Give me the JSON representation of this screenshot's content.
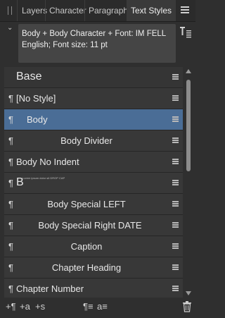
{
  "tabs": [
    {
      "label": "Layers",
      "active": false
    },
    {
      "label": "Character",
      "active": false
    },
    {
      "label": "Paragraph",
      "active": false
    },
    {
      "label": "Text Styles",
      "active": true
    }
  ],
  "description": {
    "text": "Body + Body Character + Font: IM FELL English; Font size: 11 pt"
  },
  "list": {
    "header": "Base",
    "rows": [
      {
        "label": "[No Style]",
        "align": "left",
        "selected": false
      },
      {
        "label": "Body",
        "align": "indent",
        "selected": true
      },
      {
        "label": "Body Divider",
        "align": "center",
        "selected": false
      },
      {
        "label": "Body No Indent",
        "align": "left",
        "selected": false
      },
      {
        "label": "B",
        "align": "left",
        "selected": false,
        "tiny": "Lorem ipsum dolor sit DROP CAP"
      },
      {
        "label": "Body Special LEFT",
        "align": "center",
        "selected": false
      },
      {
        "label": "Body Special Right DATE",
        "align": "center",
        "selected": false
      },
      {
        "label": "Caption",
        "align": "center",
        "selected": false
      },
      {
        "label": "Chapter Heading",
        "align": "center",
        "selected": false
      },
      {
        "label": "Chapter Number",
        "align": "left",
        "selected": false
      }
    ]
  },
  "icons": {
    "pilcrow": "¶",
    "add_paragraph_style": "+¶",
    "add_character_style": "+a",
    "add_group": "+s",
    "apply_paragraph": "¶≡",
    "apply_character": "a≡",
    "delete": "trash-icon"
  },
  "colors": {
    "selected": "#4a6d96",
    "panel": "#2f2f2f",
    "row": "#383838"
  }
}
